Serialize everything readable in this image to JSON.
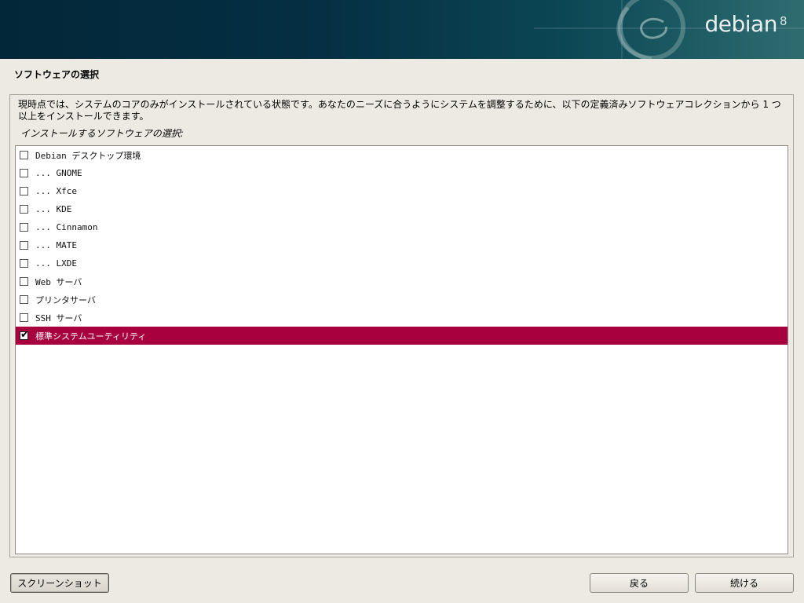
{
  "banner": {
    "brand": "debian",
    "version": "8",
    "logo_icon": "debian-swirl-icon"
  },
  "page": {
    "title": "ソフトウェアの選択",
    "description": "現時点では、システムのコアのみがインストールされている状態です。あなたのニーズに合うようにシステムを調整するために、以下の定義済みソフトウェアコレクションから 1 つ以上をインストールできます。",
    "prompt": "インストールするソフトウェアの選択:"
  },
  "software": {
    "items": [
      {
        "label": "Debian デスクトップ環境",
        "checked": false
      },
      {
        "label": "... GNOME",
        "checked": false
      },
      {
        "label": "... Xfce",
        "checked": false
      },
      {
        "label": "... KDE",
        "checked": false
      },
      {
        "label": "... Cinnamon",
        "checked": false
      },
      {
        "label": "... MATE",
        "checked": false
      },
      {
        "label": "... LXDE",
        "checked": false
      },
      {
        "label": "Web サーバ",
        "checked": false
      },
      {
        "label": "プリンタサーバ",
        "checked": false
      },
      {
        "label": "SSH サーバ",
        "checked": false
      },
      {
        "label": "標準システムユーティリティ",
        "checked": true,
        "selected": true
      }
    ],
    "check_glyph": "✔"
  },
  "buttons": {
    "screenshot": "スクリーンショット",
    "back": "戻る",
    "continue": "続ける"
  },
  "colors": {
    "selection": "#a8003f",
    "background": "#edeae3",
    "banner_dark": "#022738"
  }
}
